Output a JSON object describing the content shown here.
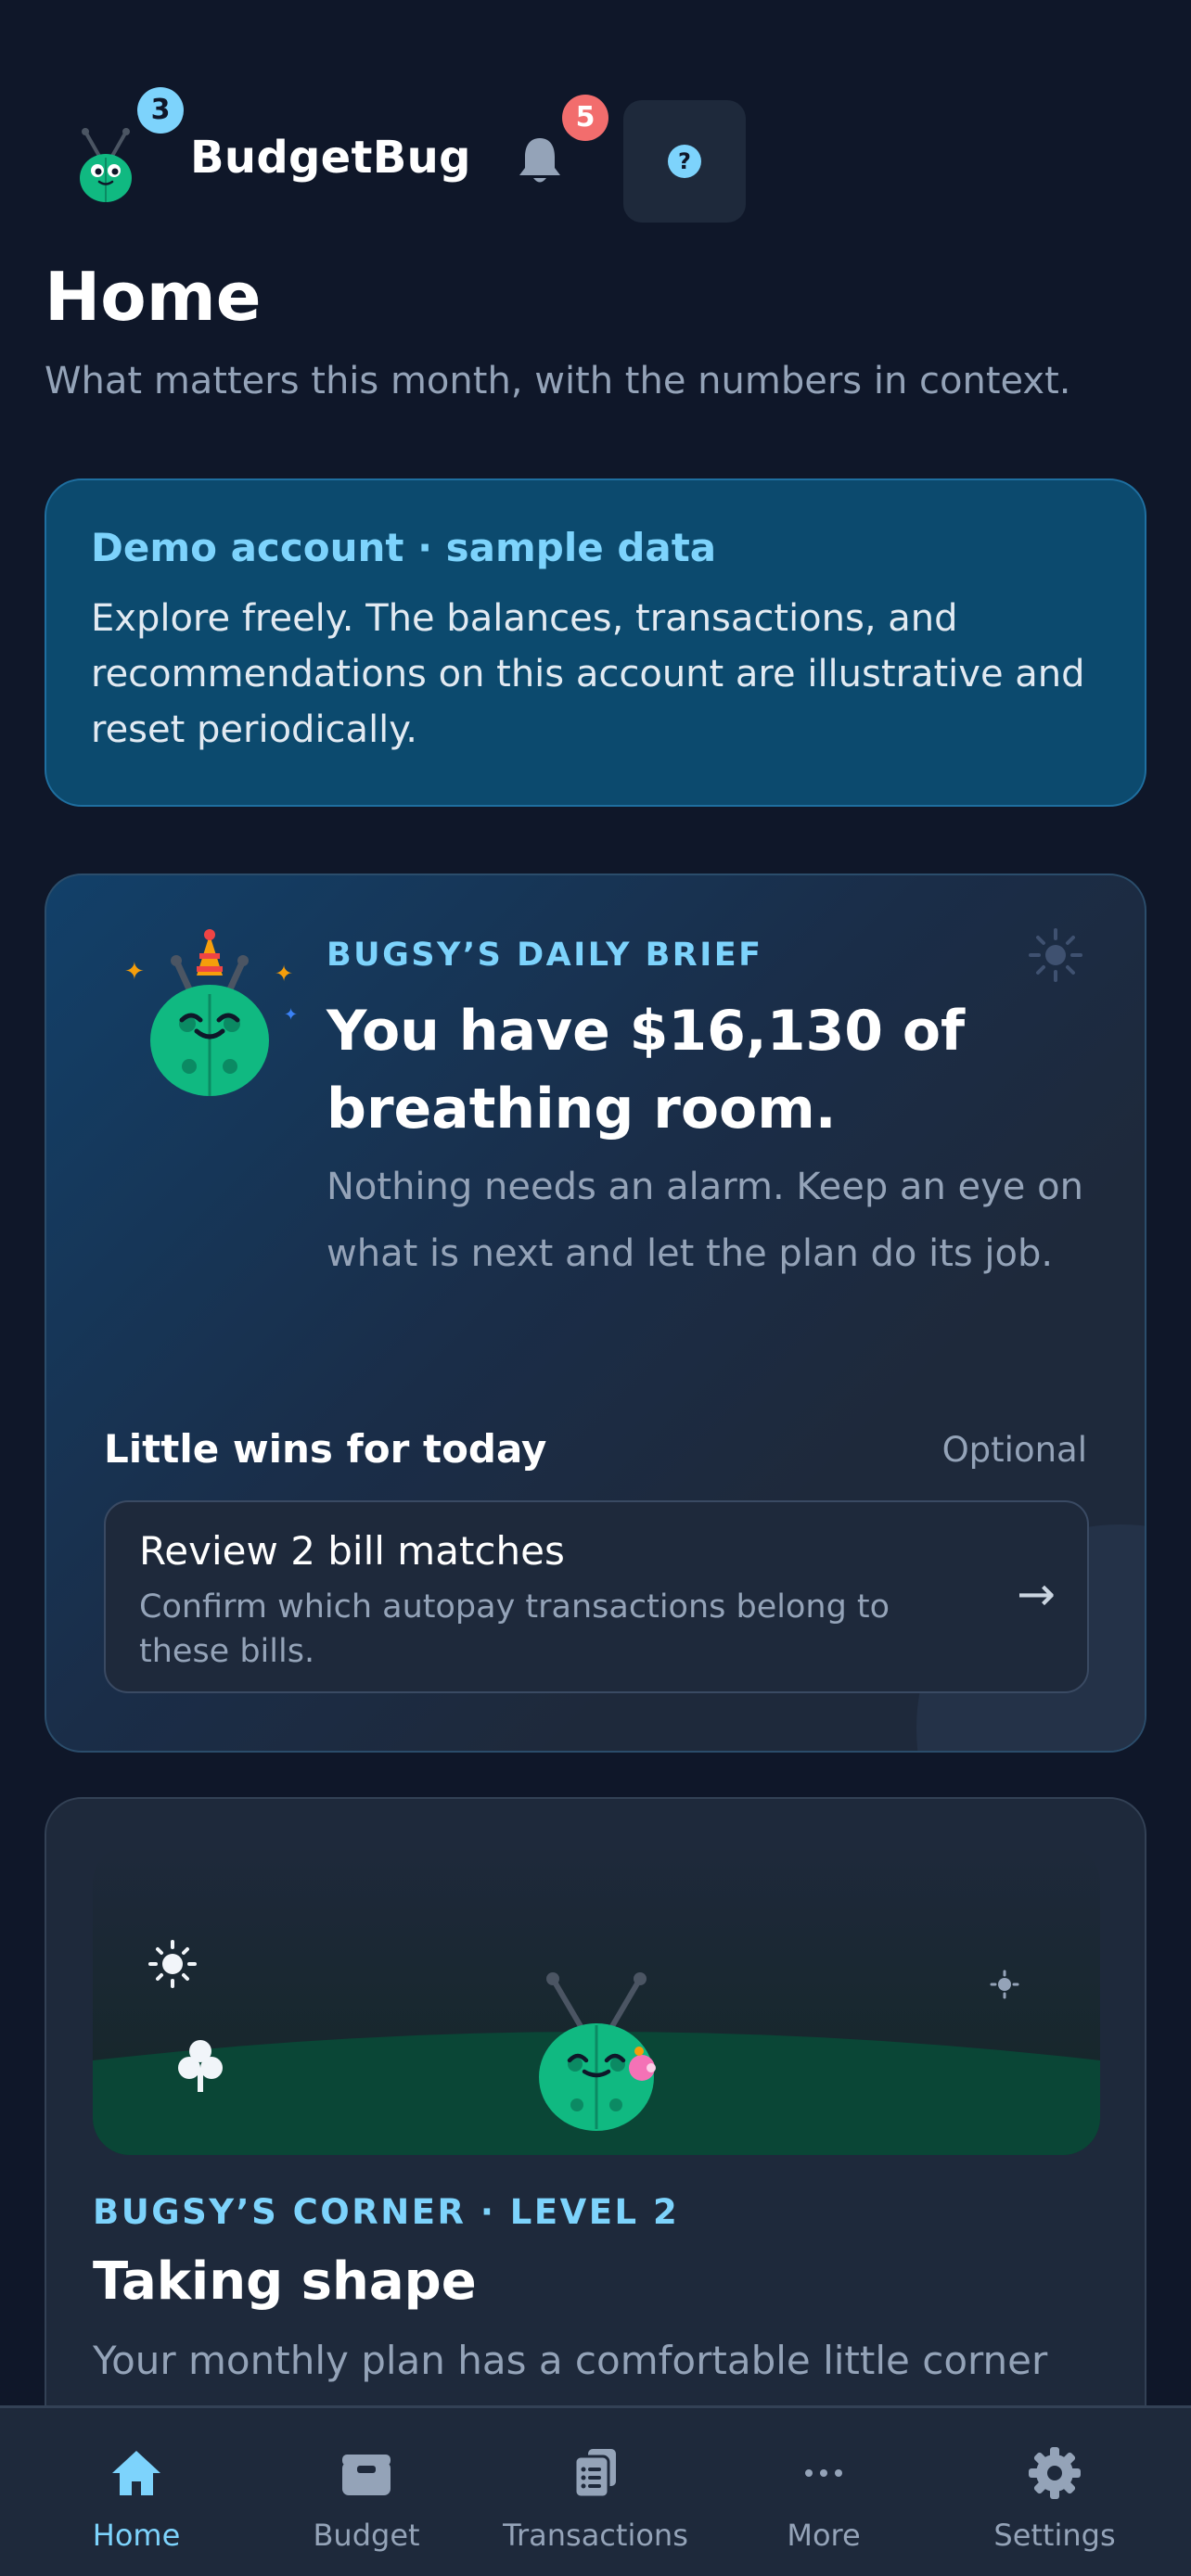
{
  "header": {
    "brand": "BudgetBug",
    "logo_badge": "3",
    "notification_count": "5",
    "help_symbol": "?"
  },
  "page": {
    "title": "Home",
    "subtitle": "What matters this month, with the numbers in context."
  },
  "demo_banner": {
    "title": "Demo account · sample data",
    "body": "Explore freely. The balances, transactions, and recommendations on this account are illustrative and reset periodically."
  },
  "daily_brief": {
    "eyebrow": "BUGSY’S DAILY BRIEF",
    "headline": "You have $16,130 of breathing room.",
    "body": "Nothing needs an alarm. Keep an eye on what is next and let the plan do its job.",
    "wins_title": "Little wins for today",
    "wins_optional": "Optional",
    "wins": [
      {
        "title": "Review 2 bill matches",
        "description": "Confirm which autopay transactions belong to these bills.",
        "arrow": "→"
      }
    ]
  },
  "corner": {
    "eyebrow": "BUGSY’S CORNER · LEVEL 2",
    "title": "Taking shape",
    "body": "Your monthly plan has a comfortable little corner"
  },
  "bottom_nav": [
    {
      "label": "Home",
      "icon": "home-icon",
      "active": true
    },
    {
      "label": "Budget",
      "icon": "wallet-icon",
      "active": false
    },
    {
      "label": "Transactions",
      "icon": "receipt-icon",
      "active": false
    },
    {
      "label": "More",
      "icon": "more-icon",
      "active": false
    },
    {
      "label": "Settings",
      "icon": "gear-icon",
      "active": false
    }
  ],
  "colors": {
    "background": "#0f1729",
    "card": "#1e293b",
    "accent": "#7dd3fc",
    "bug_green": "#10b981",
    "alert": "#f26d6d",
    "banner": "#0c4a6e"
  }
}
